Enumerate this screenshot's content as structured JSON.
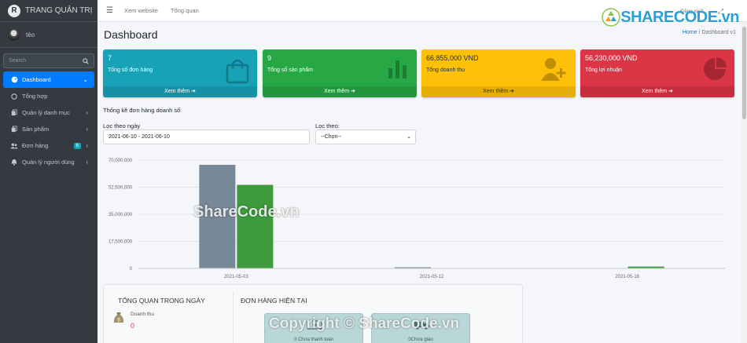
{
  "brand": {
    "title": "TRANG QUẢN TRỊ",
    "logo_letter": "R"
  },
  "user": {
    "name": "tèo"
  },
  "sidebar": {
    "search_placeholder": "Search",
    "items": [
      {
        "label": "Dashboard",
        "icon": "dashboard-icon"
      },
      {
        "label": "Tổng hợp",
        "icon": "circle-icon"
      },
      {
        "label": "Quản lý danh mục",
        "icon": "copy-icon"
      },
      {
        "label": "Sản phẩm",
        "icon": "copy-icon"
      },
      {
        "label": "Đơn hàng",
        "icon": "users-icon",
        "badge": "6"
      },
      {
        "label": "Quản lý người dùng",
        "icon": "bell-icon"
      }
    ]
  },
  "topnav": {
    "links": [
      "Xem website",
      "Tổng quan"
    ],
    "logout": "Đăng xuất"
  },
  "page": {
    "title": "Dashboard"
  },
  "breadcrumb": {
    "home": "Home",
    "separator": "/",
    "current": "Dashboard v1"
  },
  "boxes": [
    {
      "value": "7",
      "label": "Tổng số đơn hàng",
      "link": "Xem thêm",
      "color": "#17a2b8"
    },
    {
      "value": "9",
      "label": "Tổng số sản phẩm",
      "link": "Xem thêm",
      "color": "#28a745"
    },
    {
      "value": "66,855,000 VND",
      "label": "Tổng doanh thu",
      "link": "Xem thêm",
      "color": "#ffc107"
    },
    {
      "value": "56,230,000 VND",
      "label": "Tổng lợi nhuận",
      "link": "Xem thêm",
      "color": "#dc3545"
    }
  ],
  "stats": {
    "title": "Thống kê đơn hàng doanh số",
    "filter_date_label": "Lọc theo ngày",
    "filter_date_value": "2021-06-10 - 2021-06-10",
    "filter_by_label": "Lọc theo:",
    "filter_by_value": "--Chọn--"
  },
  "chart_data": {
    "type": "bar",
    "categories": [
      "2021-05-03",
      "2021-05-12",
      "2021-05-18"
    ],
    "series": [
      {
        "values": [
          67000000,
          200000,
          0
        ],
        "color": "#778899"
      },
      {
        "values": [
          54000000,
          0,
          1200000
        ],
        "color": "#3d9b3d"
      }
    ],
    "ylim": [
      0,
      70000000
    ],
    "yticks": [
      "0",
      "17,500,000",
      "35,000,000",
      "52,500,000",
      "70,000,000"
    ],
    "ytick_values": [
      0,
      17500000,
      35000000,
      52500000,
      70000000
    ],
    "grid": true
  },
  "bottom": {
    "overview_title": "TỔNG QUAN TRONG NGÀY",
    "revenue_label": "Doanh thu",
    "revenue_value": "0",
    "orders_title": "ĐƠN HÀNG HIỆN TẠI",
    "unpaid_label": "0 Chưa thanh toán",
    "undelivered_label": "0Chưa giao"
  },
  "watermarks": {
    "logo": "SHARECODE.vn",
    "center": "ShareCode.vn",
    "copyright": "Copyright © ShareCode.vn"
  }
}
